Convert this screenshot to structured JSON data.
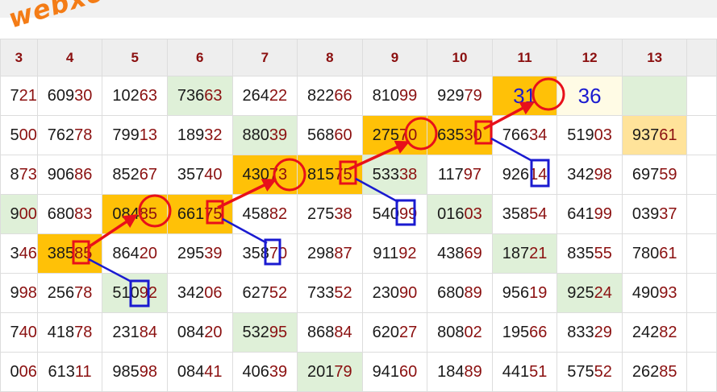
{
  "site": {
    "watermark": "webxoso.net"
  },
  "header": {
    "columns": [
      "3",
      "4",
      "5",
      "6",
      "7",
      "8",
      "9",
      "10",
      "11",
      "12",
      "13",
      ""
    ]
  },
  "rows": [
    [
      {
        "p": "7",
        "t": "21",
        "bg": "w"
      },
      {
        "p": "609",
        "t": "30",
        "bg": "w"
      },
      {
        "p": "102",
        "t": "63",
        "bg": "w"
      },
      {
        "p": "736",
        "t": "63",
        "bg": "g"
      },
      {
        "p": "264",
        "t": "22",
        "bg": "w"
      },
      {
        "p": "822",
        "t": "66",
        "bg": "w"
      },
      {
        "p": "810",
        "t": "99",
        "bg": "w"
      },
      {
        "p": "929",
        "t": "79",
        "bg": "w"
      },
      {
        "p": "",
        "t": "31",
        "bg": "o",
        "special": "blue"
      },
      {
        "p": "",
        "t": "36",
        "bg": "l",
        "special": "blue"
      },
      {
        "p": "",
        "t": "",
        "bg": "g"
      },
      {
        "p": "",
        "t": "",
        "bg": "w"
      }
    ],
    [
      {
        "p": "5",
        "t": "00",
        "bg": "w"
      },
      {
        "p": "762",
        "t": "78",
        "bg": "w"
      },
      {
        "p": "799",
        "t": "13",
        "bg": "w"
      },
      {
        "p": "189",
        "t": "32",
        "bg": "w"
      },
      {
        "p": "880",
        "t": "39",
        "bg": "g"
      },
      {
        "p": "568",
        "t": "60",
        "bg": "w"
      },
      {
        "p": "275",
        "t": "70",
        "bg": "o"
      },
      {
        "p": "635",
        "t": "30",
        "bg": "o"
      },
      {
        "p": "766",
        "t": "34",
        "bg": "w"
      },
      {
        "p": "519",
        "t": "03",
        "bg": "w"
      },
      {
        "p": "937",
        "t": "61",
        "bg": "y"
      },
      {
        "p": "",
        "t": "",
        "bg": "w"
      }
    ],
    [
      {
        "p": "8",
        "t": "73",
        "bg": "w"
      },
      {
        "p": "906",
        "t": "86",
        "bg": "w"
      },
      {
        "p": "852",
        "t": "67",
        "bg": "w"
      },
      {
        "p": "357",
        "t": "40",
        "bg": "w"
      },
      {
        "p": "430",
        "t": "73",
        "bg": "o"
      },
      {
        "p": "815",
        "t": "75",
        "bg": "o"
      },
      {
        "p": "533",
        "t": "38",
        "bg": "g"
      },
      {
        "p": "117",
        "t": "97",
        "bg": "w"
      },
      {
        "p": "926",
        "t": "14",
        "bg": "w"
      },
      {
        "p": "342",
        "t": "98",
        "bg": "w"
      },
      {
        "p": "697",
        "t": "59",
        "bg": "w"
      },
      {
        "p": "",
        "t": "",
        "bg": "w"
      }
    ],
    [
      {
        "p": "9",
        "t": "00",
        "bg": "g"
      },
      {
        "p": "680",
        "t": "83",
        "bg": "w"
      },
      {
        "p": "084",
        "t": "85",
        "bg": "o"
      },
      {
        "p": "661",
        "t": "75",
        "bg": "o"
      },
      {
        "p": "458",
        "t": "82",
        "bg": "w"
      },
      {
        "p": "275",
        "t": "38",
        "bg": "w"
      },
      {
        "p": "540",
        "t": "99",
        "bg": "w"
      },
      {
        "p": "016",
        "t": "03",
        "bg": "g"
      },
      {
        "p": "358",
        "t": "54",
        "bg": "w"
      },
      {
        "p": "641",
        "t": "99",
        "bg": "w"
      },
      {
        "p": "039",
        "t": "37",
        "bg": "w"
      },
      {
        "p": "",
        "t": "",
        "bg": "w"
      }
    ],
    [
      {
        "p": "3",
        "t": "46",
        "bg": "w"
      },
      {
        "p": "385",
        "t": "85",
        "bg": "o"
      },
      {
        "p": "864",
        "t": "20",
        "bg": "w"
      },
      {
        "p": "295",
        "t": "39",
        "bg": "w"
      },
      {
        "p": "358",
        "t": "70",
        "bg": "w"
      },
      {
        "p": "298",
        "t": "87",
        "bg": "w"
      },
      {
        "p": "911",
        "t": "92",
        "bg": "w"
      },
      {
        "p": "438",
        "t": "69",
        "bg": "w"
      },
      {
        "p": "187",
        "t": "21",
        "bg": "g"
      },
      {
        "p": "835",
        "t": "55",
        "bg": "w"
      },
      {
        "p": "780",
        "t": "61",
        "bg": "w"
      },
      {
        "p": "",
        "t": "",
        "bg": "w"
      }
    ],
    [
      {
        "p": "9",
        "t": "98",
        "bg": "w"
      },
      {
        "p": "256",
        "t": "78",
        "bg": "w"
      },
      {
        "p": "510",
        "t": "92",
        "bg": "g"
      },
      {
        "p": "342",
        "t": "06",
        "bg": "w"
      },
      {
        "p": "627",
        "t": "52",
        "bg": "w"
      },
      {
        "p": "733",
        "t": "52",
        "bg": "w"
      },
      {
        "p": "230",
        "t": "90",
        "bg": "w"
      },
      {
        "p": "680",
        "t": "89",
        "bg": "w"
      },
      {
        "p": "956",
        "t": "19",
        "bg": "w"
      },
      {
        "p": "925",
        "t": "24",
        "bg": "g"
      },
      {
        "p": "490",
        "t": "93",
        "bg": "w"
      },
      {
        "p": "",
        "t": "",
        "bg": "w"
      }
    ],
    [
      {
        "p": "7",
        "t": "40",
        "bg": "w"
      },
      {
        "p": "418",
        "t": "78",
        "bg": "w"
      },
      {
        "p": "231",
        "t": "84",
        "bg": "w"
      },
      {
        "p": "084",
        "t": "20",
        "bg": "w"
      },
      {
        "p": "532",
        "t": "95",
        "bg": "g"
      },
      {
        "p": "868",
        "t": "84",
        "bg": "w"
      },
      {
        "p": "620",
        "t": "27",
        "bg": "w"
      },
      {
        "p": "808",
        "t": "02",
        "bg": "w"
      },
      {
        "p": "195",
        "t": "66",
        "bg": "w"
      },
      {
        "p": "833",
        "t": "29",
        "bg": "w"
      },
      {
        "p": "242",
        "t": "82",
        "bg": "w"
      },
      {
        "p": "",
        "t": "",
        "bg": "w"
      }
    ],
    [
      {
        "p": "0",
        "t": "06",
        "bg": "w"
      },
      {
        "p": "613",
        "t": "11",
        "bg": "w"
      },
      {
        "p": "985",
        "t": "98",
        "bg": "w"
      },
      {
        "p": "084",
        "t": "41",
        "bg": "w"
      },
      {
        "p": "406",
        "t": "39",
        "bg": "w"
      },
      {
        "p": "201",
        "t": "79",
        "bg": "g"
      },
      {
        "p": "941",
        "t": "60",
        "bg": "w"
      },
      {
        "p": "184",
        "t": "89",
        "bg": "w"
      },
      {
        "p": "441",
        "t": "51",
        "bg": "w"
      },
      {
        "p": "575",
        "t": "52",
        "bg": "w"
      },
      {
        "p": "262",
        "t": "85",
        "bg": "w"
      },
      {
        "p": "",
        "t": "",
        "bg": "w"
      }
    ]
  ]
}
